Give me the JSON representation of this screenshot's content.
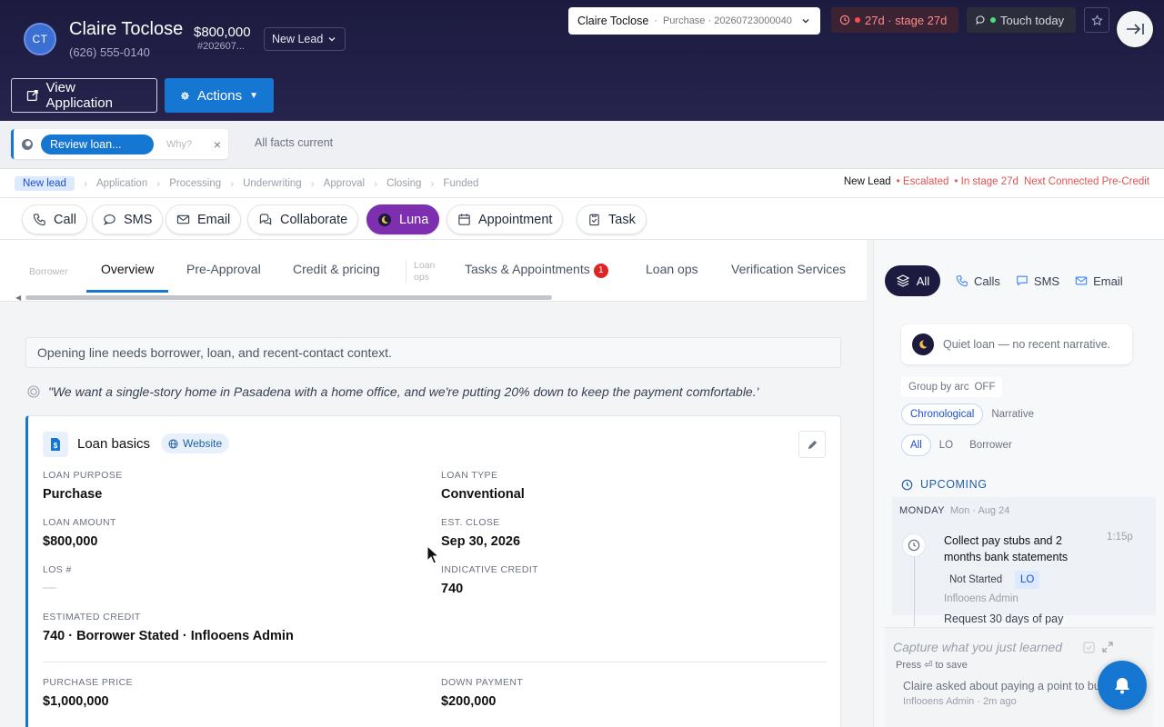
{
  "header": {
    "initials": "CT",
    "name": "Claire Toclose",
    "phone": "(626) 555-0140",
    "amount": "$800,000",
    "ref": "#202607...",
    "status": "New Lead",
    "loan_select": {
      "name": "Claire Toclose",
      "sep": "·",
      "detail": "Purchase · 20260723000040"
    },
    "stage_chip": "27d · stage 27d",
    "touch_chip": "Touch today",
    "view_application": "View Application",
    "actions": "Actions"
  },
  "review": {
    "button": "Review loan...",
    "why": "Why?",
    "close": "×",
    "facts": "All facts current"
  },
  "pipeline": {
    "stages": [
      "New lead",
      "Application",
      "Processing",
      "Underwriting",
      "Approval",
      "Closing",
      "Funded"
    ],
    "status": "New Lead",
    "escalated": "• Escalated",
    "in_stage": "• In stage 27d",
    "next": "Next Connected Pre-Credit"
  },
  "action_buttons": {
    "call": "Call",
    "sms": "SMS",
    "email": "Email",
    "collaborate": "Collaborate",
    "luna": "Luna",
    "appointment": "Appointment",
    "task": "Task"
  },
  "tabs": {
    "borrower": "Borrower",
    "overview": "Overview",
    "preapproval": "Pre-Approval",
    "credit": "Credit & pricing",
    "loan_ops_small": "Loan ops",
    "tasks": "Tasks & Appointments",
    "tasks_badge": "1",
    "loan_ops": "Loan ops",
    "verification": "Verification Services"
  },
  "main": {
    "opening": "Opening line needs borrower, loan, and recent-contact context.",
    "quote": "\"We want a single-story home in Pasadena with a home office, and we're putting 20% down to keep the payment comfortable.'"
  },
  "loan_basics": {
    "title": "Loan basics",
    "source": "Website",
    "fields": {
      "purpose_label": "LOAN PURPOSE",
      "purpose": "Purchase",
      "type_label": "LOAN TYPE",
      "type": "Conventional",
      "amount_label": "LOAN AMOUNT",
      "amount": "$800,000",
      "close_label": "EST. CLOSE",
      "close": "Sep 30, 2026",
      "los_label": "LOS #",
      "los": "—",
      "credit_label": "INDICATIVE CREDIT",
      "credit": "740",
      "est_credit_label": "ESTIMATED CREDIT",
      "est_credit": "740 · Borrower Stated · Inflooens Admin",
      "price_label": "PURCHASE PRICE",
      "price": "$1,000,000",
      "down_label": "DOWN PAYMENT",
      "down": "$200,000"
    }
  },
  "right_panel": {
    "tabs": {
      "all": "All",
      "calls": "Calls",
      "sms": "SMS",
      "email": "Email"
    },
    "quiet": "Quiet loan — no recent narrative.",
    "group_by": "Group by arc",
    "group_state": "OFF",
    "view_modes": [
      "Chronological",
      "Narrative"
    ],
    "filters": [
      "All",
      "LO",
      "Borrower"
    ],
    "upcoming": "UPCOMING",
    "day": "MONDAY",
    "day_sub": "Mon · Aug 24",
    "task": {
      "title": "Collect pay stubs and 2 months bank statements",
      "time": "1:15p",
      "status": "Not Started",
      "role": "LO",
      "owner": "Inflooens Admin",
      "detail": "Request 30 days of pay"
    },
    "capture_placeholder": "Capture what you just learned",
    "press_hint": "Press ⏎ to save",
    "note": "Claire asked about paying a point to buy down",
    "note_meta": "Inflooens Admin · 2m ago"
  },
  "colors": {
    "header_bg": "#1c1b3f",
    "accent": "#1677d2",
    "luna": "#7e2fb0",
    "alert": "#e05252"
  }
}
